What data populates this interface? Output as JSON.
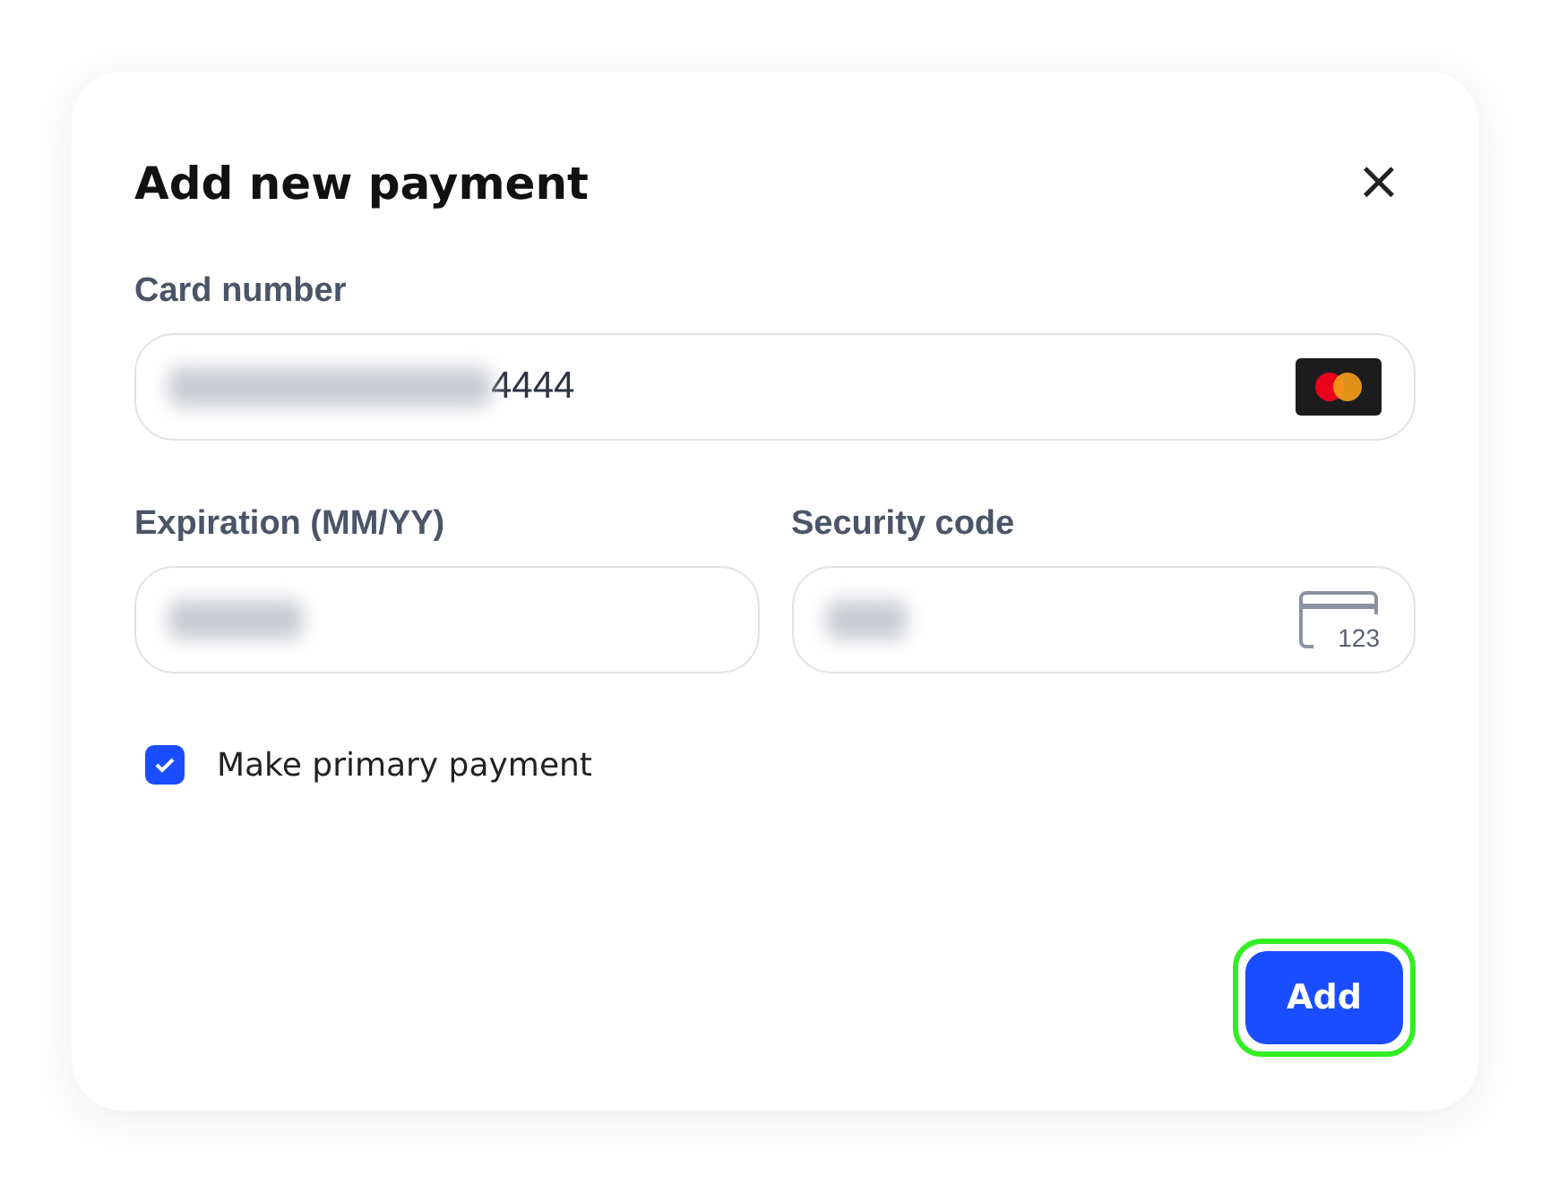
{
  "dialog": {
    "title": "Add new payment",
    "close": "×"
  },
  "card_number": {
    "label": "Card number",
    "value": "4444",
    "redacted": true
  },
  "fields": [
    {
      "label": "Expiration (MM/YY)",
      "redacted": true
    },
    {
      "label": "Security code",
      "redacted": true,
      "icon_text": "123"
    }
  ],
  "primary": {
    "label": "Make primary payment",
    "checked": true
  },
  "add_button": {
    "label": "Add",
    "focused": true
  }
}
